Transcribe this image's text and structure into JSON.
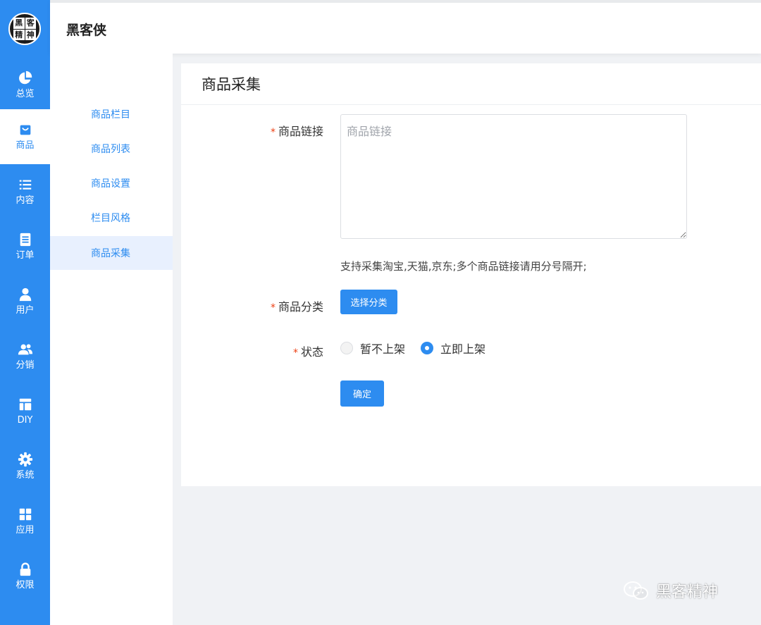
{
  "app": {
    "brand": "黑客侠"
  },
  "logo": {
    "chars": [
      "黑",
      "客",
      "精",
      "神"
    ]
  },
  "rail": {
    "items": [
      {
        "label": "总览",
        "icon": "pie-chart-icon"
      },
      {
        "label": "商品",
        "icon": "shopping-bag-icon",
        "active": true
      },
      {
        "label": "内容",
        "icon": "list-icon"
      },
      {
        "label": "订单",
        "icon": "order-document-icon"
      },
      {
        "label": "用户",
        "icon": "user-icon"
      },
      {
        "label": "分销",
        "icon": "group-icon"
      },
      {
        "label": "DIY",
        "icon": "layout-icon"
      },
      {
        "label": "系统",
        "icon": "gear-icon"
      },
      {
        "label": "应用",
        "icon": "apps-grid-icon"
      },
      {
        "label": "权限",
        "icon": "lock-icon"
      }
    ]
  },
  "submenu": {
    "items": [
      {
        "label": "商品栏目"
      },
      {
        "label": "商品列表"
      },
      {
        "label": "商品设置"
      },
      {
        "label": "栏目风格"
      },
      {
        "label": "商品采集",
        "active": true
      }
    ]
  },
  "page": {
    "title": "商品采集",
    "form": {
      "link": {
        "required_mark": "*",
        "label": "商品链接",
        "placeholder": "商品链接",
        "value": ""
      },
      "hint": "支持采集淘宝,天猫,京东;多个商品链接请用分号隔开;",
      "category": {
        "required_mark": "*",
        "label": "商品分类",
        "button_label": "选择分类"
      },
      "status": {
        "required_mark": "*",
        "label": "状态",
        "options": [
          {
            "label": "暂不上架",
            "selected": false
          },
          {
            "label": "立即上架",
            "selected": true
          }
        ]
      },
      "submit_label": "确定"
    }
  },
  "watermark": {
    "text": "黑客精神",
    "icon": "wechat-icon"
  },
  "colors": {
    "primary": "#2d8cf0",
    "required": "#ed4014"
  }
}
